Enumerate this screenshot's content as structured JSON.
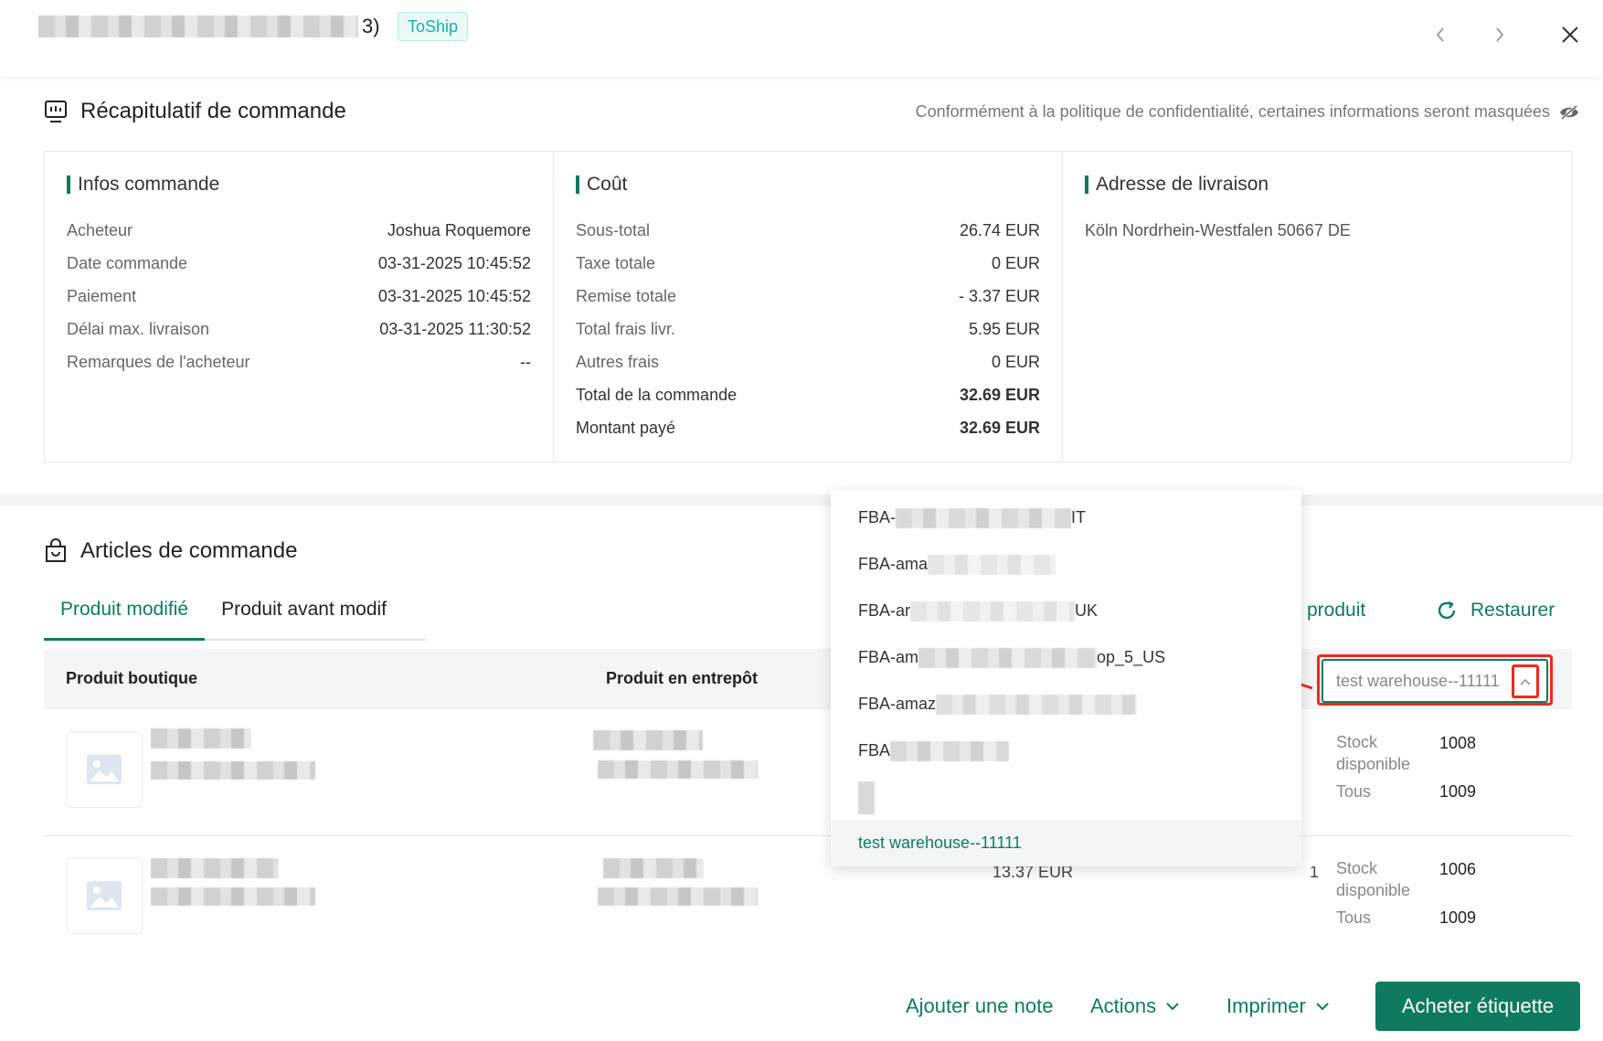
{
  "header": {
    "order_suffix": "3)",
    "status_badge": "ToShip"
  },
  "summary_section": {
    "title": "Récapitulatif de commande",
    "privacy_notice": "Conformément à la politique de confidentialité, certaines informations seront masquées",
    "order_info": {
      "title": "Infos commande",
      "rows": [
        {
          "label": "Acheteur",
          "value": "Joshua Roquemore"
        },
        {
          "label": "Date commande",
          "value": "03-31-2025 10:45:52"
        },
        {
          "label": "Paiement",
          "value": "03-31-2025 10:45:52"
        },
        {
          "label": "Délai max. livraison",
          "value": "03-31-2025 11:30:52"
        },
        {
          "label": "Remarques de l'acheteur",
          "value": "--"
        }
      ]
    },
    "cost": {
      "title": "Coût",
      "rows": [
        {
          "label": "Sous-total",
          "value": "26.74 EUR"
        },
        {
          "label": "Taxe totale",
          "value": "0 EUR"
        },
        {
          "label": "Remise totale",
          "value": "- 3.37 EUR"
        },
        {
          "label": "Total frais livr.",
          "value": "5.95 EUR"
        },
        {
          "label": "Autres frais",
          "value": "0 EUR"
        },
        {
          "label": "Total de la commande",
          "value": "32.69 EUR"
        },
        {
          "label": "Montant payé",
          "value": "32.69 EUR"
        }
      ]
    },
    "address": {
      "title": "Adresse de livraison",
      "line": "Köln Nordrhein-Westfalen 50667 DE"
    }
  },
  "items_section": {
    "title": "Articles de commande",
    "tabs": [
      "Produit modifié",
      "Produit avant modif"
    ],
    "modify_product_partial": "fier produit",
    "restore_label": "Restaurer",
    "columns": {
      "shop_product": "Produit boutique",
      "warehouse_product": "Produit en entrepôt"
    },
    "rows": [
      {
        "stock_label": "Stock disponible",
        "stock_value": "1008",
        "all_label": "Tous",
        "all_value": "1009"
      },
      {
        "price_partial": "13.37 EUR",
        "qty_partial": "1",
        "stock_label": "Stock disponible",
        "stock_value": "1006",
        "all_label": "Tous",
        "all_value": "1009"
      }
    ],
    "warehouse_select": {
      "value": "test warehouse--11111"
    }
  },
  "dropdown": {
    "options": [
      {
        "prefix": "FBA-",
        "suffix": "IT"
      },
      {
        "prefix": "FBA-ama",
        "suffix": ""
      },
      {
        "prefix": "FBA-ar",
        "suffix": "UK"
      },
      {
        "prefix": "FBA-am",
        "suffix": "op_5_US"
      },
      {
        "prefix": "FBA-amaz",
        "suffix": ""
      },
      {
        "prefix": "FBA",
        "suffix": ""
      },
      {
        "prefix": "",
        "suffix": ""
      }
    ],
    "selected": "test warehouse--11111"
  },
  "footer": {
    "add_note": "Ajouter une note",
    "actions": "Actions",
    "print": "Imprimer",
    "buy_label": "Acheter étiquette"
  },
  "colors": {
    "primary": "#0f7a5f",
    "badge_text": "#14b3a5",
    "annotation_red": "#f0281e"
  }
}
